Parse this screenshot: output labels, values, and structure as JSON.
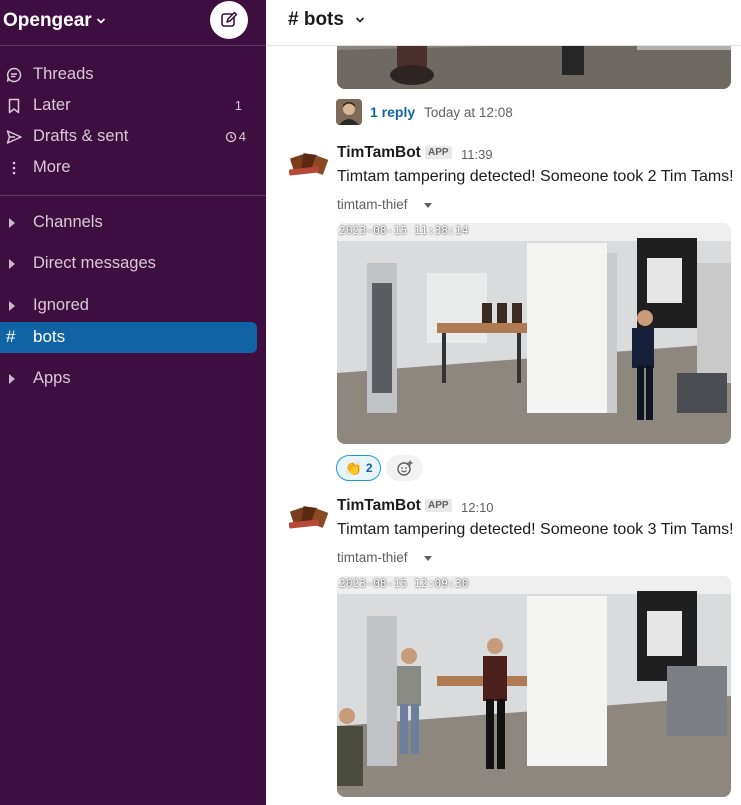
{
  "workspace": {
    "name": "Opengear",
    "compose_icon": "compose-icon"
  },
  "sidebar": {
    "nav": [
      {
        "label": "Threads",
        "icon": "threads-icon"
      },
      {
        "label": "Later",
        "icon": "bookmark-icon",
        "count": "1"
      },
      {
        "label": "Drafts & sent",
        "icon": "send-icon",
        "count": "4",
        "count_icon": "scheduled-icon"
      },
      {
        "label": "More",
        "icon": "more-vertical-icon"
      }
    ],
    "sections": [
      {
        "label": "Channels"
      },
      {
        "label": "Direct messages"
      },
      {
        "label": "Ignored"
      }
    ],
    "active_channel": {
      "hash": "#",
      "label": "bots"
    },
    "apps": {
      "label": "Apps"
    }
  },
  "channel": {
    "title": "# bots"
  },
  "thread_reply": {
    "link": "1 reply",
    "time": "Today at 12:08"
  },
  "messages": [
    {
      "sender": "TimTamBot",
      "badge": "APP",
      "time": "11:39",
      "text": "Timtam tampering detected! Someone took 2 Tim Tams!",
      "file": "timtam-thief",
      "timestamp_overlay": "2023-08-15  11:38:14",
      "reactions": [
        {
          "emoji": "👏",
          "count": "2"
        }
      ]
    },
    {
      "sender": "TimTamBot",
      "badge": "APP",
      "time": "12:10",
      "text": "Timtam tampering detected! Someone took 3 Tim Tams!",
      "file": "timtam-thief",
      "timestamp_overlay": "2023-08-15  12:09:30"
    }
  ],
  "colors": {
    "sidebar": "#3f0e40",
    "active": "#1164a3",
    "link": "#1264a3"
  }
}
